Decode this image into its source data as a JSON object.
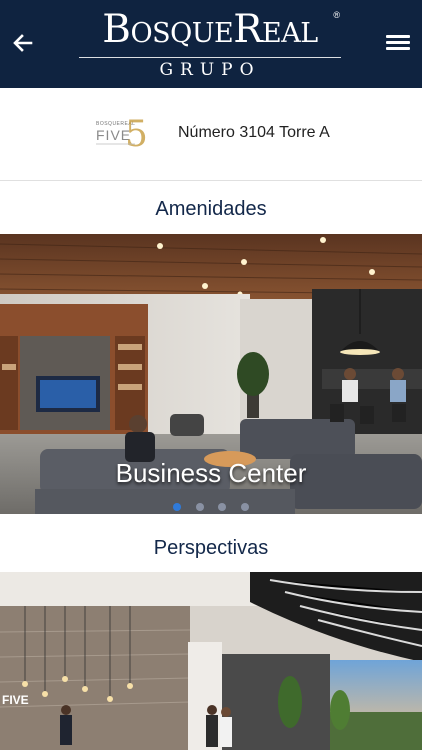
{
  "header": {
    "logo_main": "BosqueReal",
    "logo_registered": "®",
    "logo_sub": "GRUPO",
    "back_icon": "arrow-left-icon",
    "menu_icon": "hamburger-menu-icon"
  },
  "project": {
    "logo_text_top": "BOSQUEREAL",
    "logo_text_main": "FIVE",
    "logo_numeral": "5",
    "address": "Número 3104 Torre A"
  },
  "amenities": {
    "title": "Amenidades",
    "slides": [
      {
        "caption": "Business Center"
      }
    ],
    "dot_count": 4,
    "active_dot": 1
  },
  "perspectives": {
    "title": "Perspectivas"
  },
  "colors": {
    "header_bg": "#0f2340",
    "title_text": "#13284a",
    "accent_dot": "#2f7ad9",
    "logo_gold": "#c9a24a"
  }
}
